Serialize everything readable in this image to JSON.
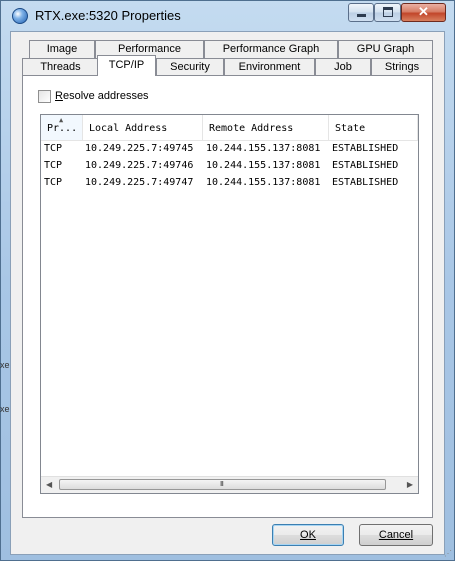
{
  "window": {
    "title": "RTX.exe:5320 Properties",
    "icon": "process-explorer-globe-icon",
    "controls": {
      "minimize": "minimize-icon",
      "maximize": "maximize-icon",
      "close": "close-icon"
    }
  },
  "tabs": {
    "row_back": [
      "Image",
      "Performance",
      "Performance Graph",
      "GPU Graph"
    ],
    "row_front": [
      "Threads",
      "TCP/IP",
      "Security",
      "Environment",
      "Job",
      "Strings"
    ],
    "selected": "TCP/IP"
  },
  "options": {
    "resolve_addresses_label": "Resolve addresses",
    "resolve_addresses_checked": false
  },
  "table": {
    "columns": [
      "Pr...",
      "Local Address",
      "Remote Address",
      "State"
    ],
    "rows": [
      [
        "TCP",
        "10.249.225.7:49745",
        "10.244.155.137:8081",
        "ESTABLISHED"
      ],
      [
        "TCP",
        "10.249.225.7:49746",
        "10.244.155.137:8081",
        "ESTABLISHED"
      ],
      [
        "TCP",
        "10.249.225.7:49747",
        "10.244.155.137:8081",
        "ESTABLISHED"
      ]
    ],
    "scrollbar_grip": "III"
  },
  "buttons": {
    "ok": "OK",
    "cancel": "Cancel"
  },
  "background_fragments": [
    "xe",
    "xe"
  ]
}
